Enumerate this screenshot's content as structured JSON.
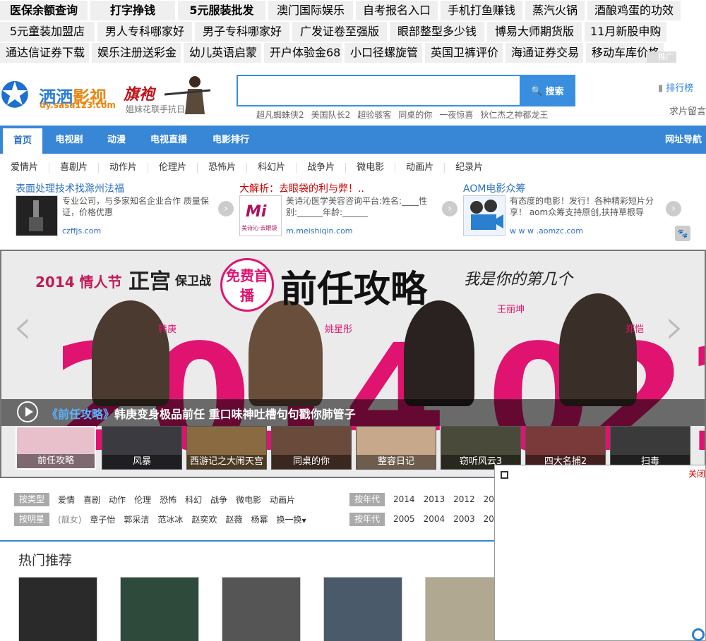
{
  "ads": {
    "row0": [
      "医保余额查询",
      "打字挣钱",
      "5元服装批发",
      "澳门国际娱乐",
      "自考报名入口",
      "手机打鱼赚钱",
      "蒸汽火锅",
      "酒酿鸡蛋的功效"
    ],
    "row1": [
      "5元童装加盟店",
      "男人专科哪家好",
      "男子专科哪家好",
      "广发证卷至强版",
      "眼部整型多少钱",
      "博易大师期货版",
      "11月新股申购"
    ],
    "row2": [
      "通达信证券下载",
      "娱乐注册送彩金",
      "幼儿英语启蒙",
      "开户体验金68",
      "小口径螺旋管",
      "英国卫裤评价",
      "海通证券交易",
      "移动车库价格"
    ],
    "tag": "推广"
  },
  "header": {
    "logo_name_a": "洒洒",
    "logo_name_b": "影视",
    "logo_url": "dy.sasa123.com",
    "promo_title": "旗袍",
    "promo_sub": "姐妹花联手抗日"
  },
  "search": {
    "value": "",
    "button": "搜索",
    "hotwords": [
      "超凡蜘蛛侠2",
      "美国队长2",
      "超验骇客",
      "同桌的你",
      "一夜惊喜",
      "狄仁杰之神都龙王"
    ]
  },
  "links": {
    "rank": "排行榜",
    "qiupian": "求片留言"
  },
  "nav": {
    "items": [
      "首页",
      "电视剧",
      "动漫",
      "电视直播",
      "电影排行"
    ],
    "right": "网址导航"
  },
  "subnav": [
    "爱情片",
    "喜剧片",
    "动作片",
    "伦理片",
    "恐怖片",
    "科幻片",
    "战争片",
    "微电影",
    "动画片",
    "纪录片"
  ],
  "text_ads": [
    {
      "title": "表面处理技术找滁州法福",
      "desc": "专业公司，与多家知名企业合作 质量保证，价格优惠",
      "url": "czffjs.com"
    },
    {
      "title": "大解析：去眼袋的利与弊！..",
      "desc": "美诗沁医学美容咨询平台:姓名:____性别:______年龄:______",
      "url": "m.meishiqin.com",
      "thumb_text": "美诗沁·去眼袋"
    },
    {
      "title": "AOM电影众筹",
      "desc": "有态度的电影！发行！各种精彩短片分享！ aom众筹支持原创,扶持草根导",
      "url": "w w w .aomzc.com"
    }
  ],
  "banner": {
    "year": "2014",
    "prefix": "情人节",
    "zg": "正宫",
    "zg_small": "保卫战",
    "free": "免费首播",
    "title": "前任攻略",
    "script": "我是你的第几个",
    "big": "2014 0214",
    "actors": [
      "韩庚",
      "姚星彤",
      "王丽坤",
      "郑恺"
    ],
    "caption_title": "《前任攻略》",
    "caption_text": "韩庚变身极品前任  重口味神吐槽句句戳你肺管子",
    "thumbs": [
      "前任攻略",
      "风暴",
      "西游记之大闹天宫",
      "同桌的你",
      "整容日记",
      "窃听风云3",
      "四大名捕2",
      "扫毒"
    ]
  },
  "filters": {
    "type_label": "按类型",
    "types": [
      "爱情",
      "喜剧",
      "动作",
      "伦理",
      "恐怖",
      "科幻",
      "战争",
      "微电影",
      "动画片"
    ],
    "star_label": "按明星",
    "star_hint": "(靓女)",
    "stars": [
      "章子怡",
      "郭采洁",
      "范冰冰",
      "赵奕欢",
      "赵薇",
      "杨幂",
      "换一换"
    ],
    "year_label": "按年代",
    "years1": [
      "2014",
      "2013",
      "2012",
      "20"
    ],
    "years2": [
      "2005",
      "2004",
      "2003",
      "20"
    ]
  },
  "hot": {
    "title": "热门推荐"
  },
  "popup": {
    "close": "关闭"
  },
  "colors": {
    "brand": "#3886d6",
    "accent": "#e01470"
  }
}
